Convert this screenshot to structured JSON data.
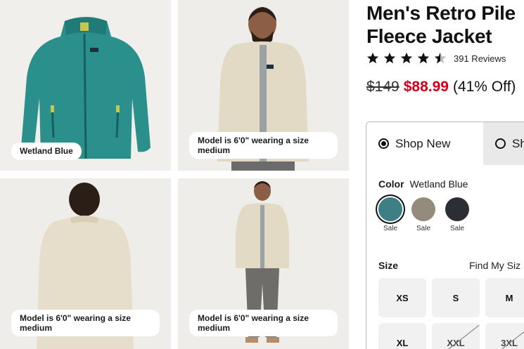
{
  "gallery": {
    "captions": [
      "Wetland Blue",
      "Model is 6'0\" wearing a size medium",
      "Model is 6'0\" wearing a size medium",
      "Model is 6'0\" wearing a size medium"
    ]
  },
  "product": {
    "title": "Men's Retro Pile Fleece Jacket",
    "rating": 4.5,
    "reviews": "391 Reviews",
    "price_original": "$149",
    "price_sale": "$88.99",
    "discount": "(41% Off)"
  },
  "purchase": {
    "tab_new": "Shop New",
    "tab_used": "Sh",
    "color_label": "Color",
    "color_value": "Wetland Blue",
    "swatches": [
      {
        "color": "#3e7f86",
        "label": "Sale"
      },
      {
        "color": "#958b7c",
        "label": "Sale"
      },
      {
        "color": "#2b2e33",
        "label": "Sale"
      }
    ],
    "size_label": "Size",
    "find_size": "Find My Siz",
    "sizes": [
      "XS",
      "S",
      "M",
      "XL",
      "XXL",
      "3XL"
    ]
  },
  "colors": {
    "sale": "#d0021b",
    "accent": "#111111"
  }
}
